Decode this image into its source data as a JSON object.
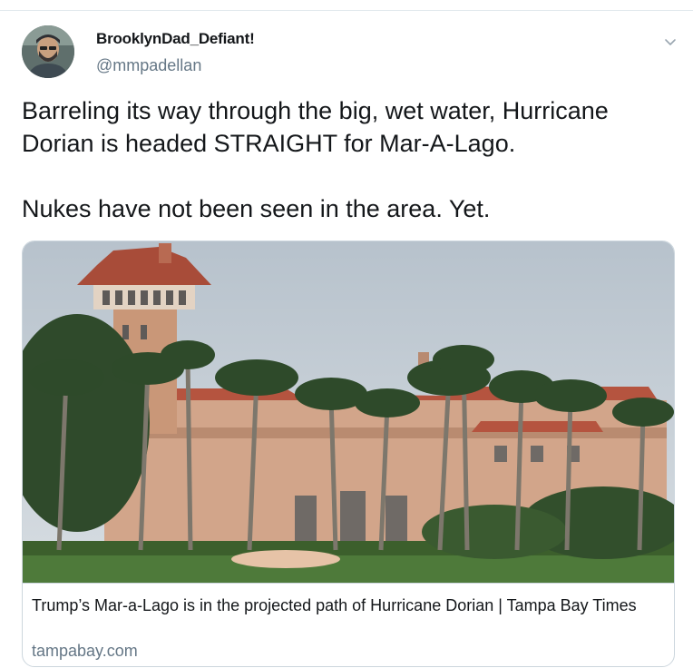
{
  "tweet": {
    "display_name": "BrooklynDad_Defiant!",
    "handle": "@mmpadellan",
    "text": "Barreling its way through the big, wet water, Hurricane\nDorian is headed STRAIGHT for Mar-A-Lago.\n\nNukes have not been seen in the area. Yet.",
    "menu_icon": "chevron-down-icon"
  },
  "card": {
    "title": "Trump’s Mar-a-Lago is in the projected path of Hurricane Dorian | Tampa Bay Times",
    "domain": "tampabay.com"
  },
  "colors": {
    "text": "#14171a",
    "secondary": "#657786",
    "border": "#ccd6dd"
  }
}
